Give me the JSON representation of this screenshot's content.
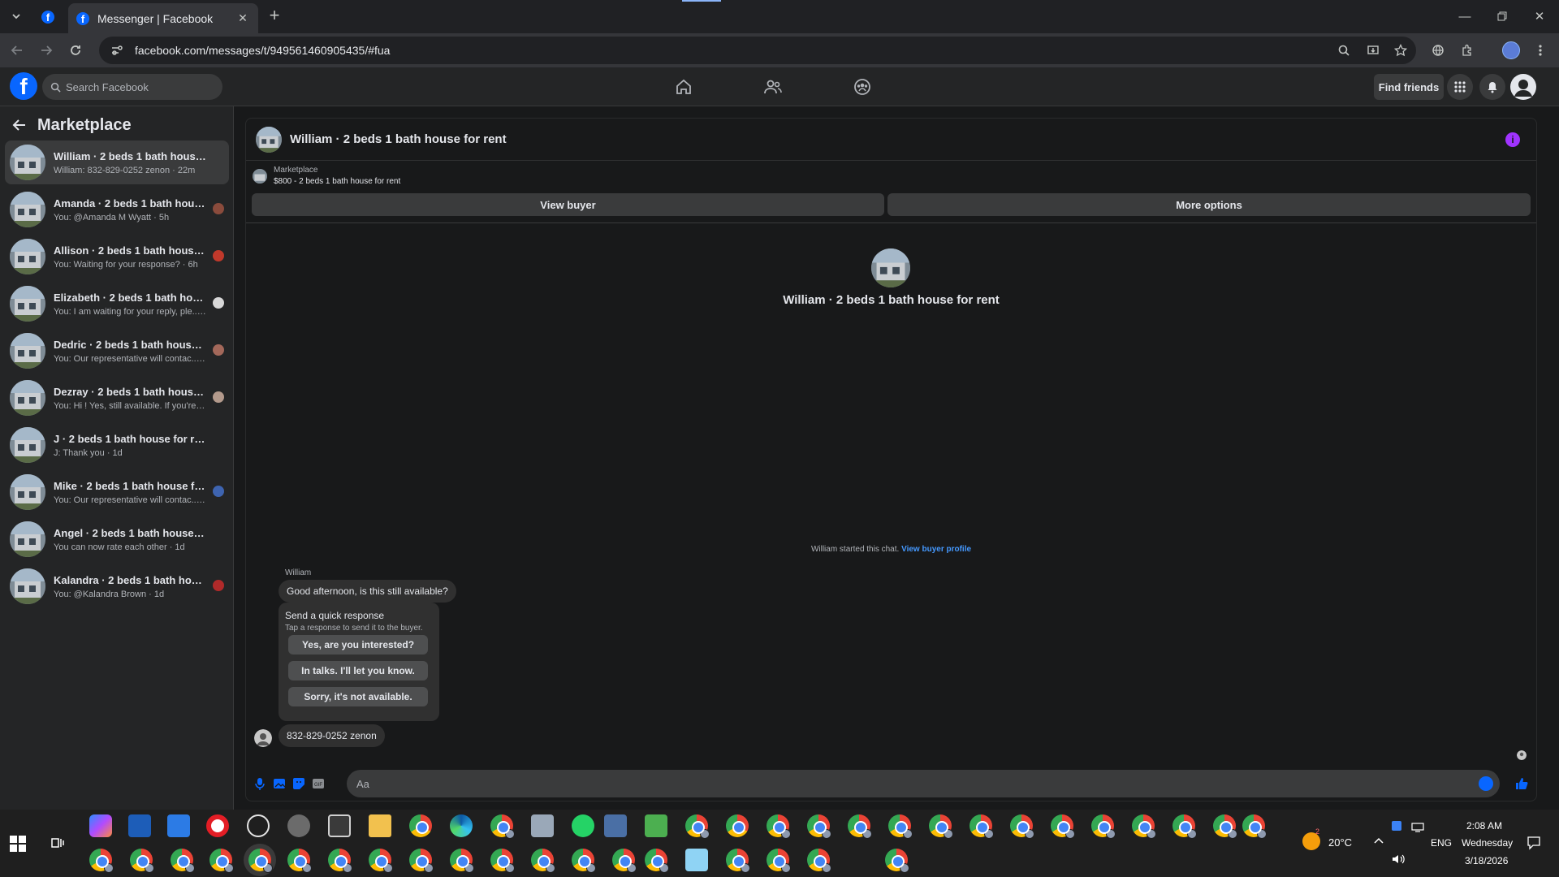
{
  "browser": {
    "tab_title": "Messenger | Facebook",
    "url": "facebook.com/messages/t/949561460905435/#fua"
  },
  "facebook": {
    "search_placeholder": "Search Facebook",
    "find_friends": "Find friends"
  },
  "sidebar": {
    "title": "Marketplace",
    "conversations": [
      {
        "name": "William · 2 beds 1 bath house for r...",
        "sub": "William: 832-829-0252 zenon · 22m",
        "active": true
      },
      {
        "name": "Amanda · 2 beds 1 bath house f...",
        "sub": "You: @Amanda M Wyatt · 5h"
      },
      {
        "name": "Allison · 2 beds 1 bath house for...",
        "sub": "You: Waiting for your response? · 6h"
      },
      {
        "name": "Elizabeth · 2 beds 1 bath house f...",
        "sub": "You: I am waiting for your reply, ple... · 6h"
      },
      {
        "name": "Dedric · 2 beds 1 bath house for ...",
        "sub": "You: Our representative will contac... · 6h"
      },
      {
        "name": "Dezray · 2 beds 1 bath house for...",
        "sub": "You: Hi ! Yes, still available. If you're... · 6h"
      },
      {
        "name": "J · 2 beds 1 bath house for rent",
        "sub": "J: Thank you · 1d"
      },
      {
        "name": "Mike · 2 beds 1 bath house for r...",
        "sub": "You: Our representative will contac... · 1d"
      },
      {
        "name": "Angel · 2 beds 1 bath house for rent",
        "sub": "You can now rate each other · 1d"
      },
      {
        "name": "Kalandra · 2 beds 1 bath house f...",
        "sub": "You: @Kalandra Brown · 1d"
      }
    ]
  },
  "chat": {
    "header_title": "William · 2 beds 1 bath house for rent",
    "listing_label": "Marketplace",
    "listing_value": "$800 - 2 beds 1 bath house for rent",
    "view_buyer": "View buyer",
    "more_options": "More options",
    "center_title": "William · 2 beds 1 bath house for rent",
    "started_text": "William started this chat.",
    "view_buyer_profile": "View buyer profile",
    "sender": "William",
    "message1": "Good afternoon, is this still available?",
    "quick_title": "Send a quick response",
    "quick_sub": "Tap a response to send it to the buyer.",
    "quick_responses": [
      "Yes, are you interested?",
      "In talks. I'll let you know.",
      "Sorry, it's not available."
    ],
    "message2": "832-829-0252 zenon",
    "composer_placeholder": "Aa"
  },
  "taskbar": {
    "weather_temp": "20°C",
    "weather_badge": "2",
    "lang": "ENG",
    "time": "2:08 AM",
    "day": "Wednesday",
    "date": "3/18/2026"
  }
}
